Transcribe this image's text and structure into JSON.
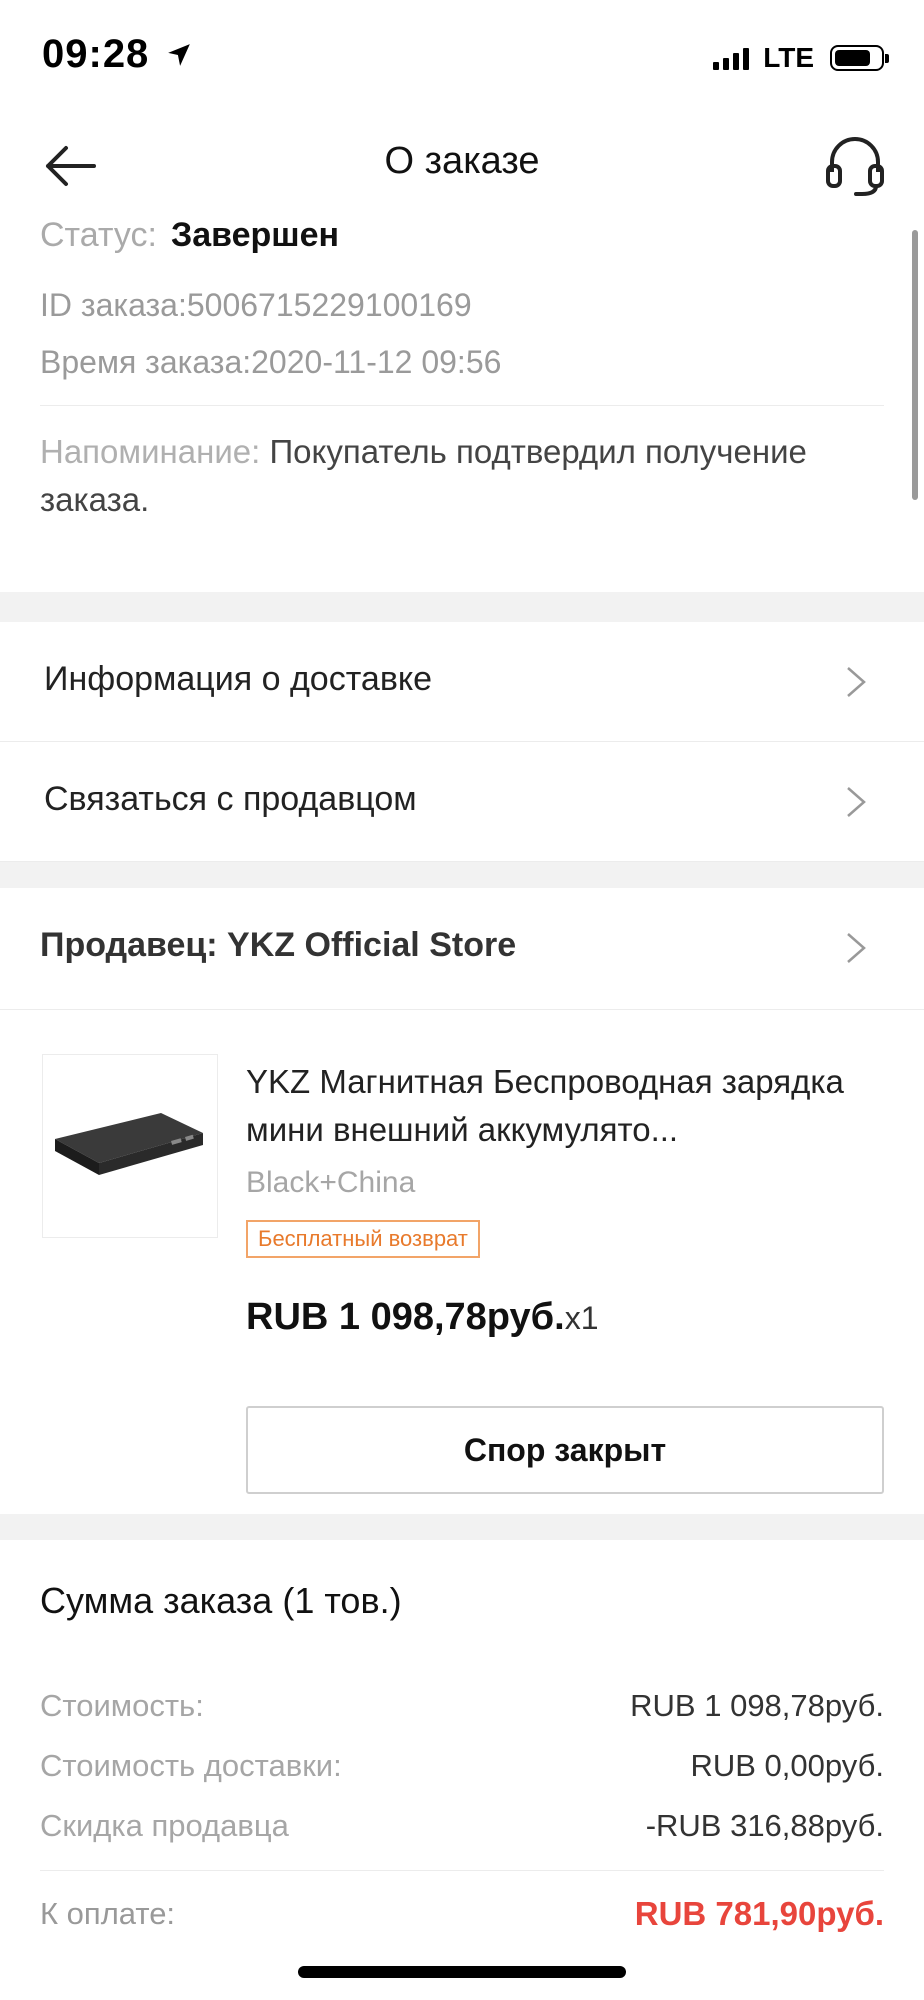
{
  "status_bar": {
    "time": "09:28",
    "network": "LTE"
  },
  "nav": {
    "title": "О заказе"
  },
  "order": {
    "status_label": "Статус:",
    "status_value": "Завершен",
    "id_line": "ID заказа:5006715229100169",
    "time_line": "Время заказа:2020-11-12 09:56",
    "reminder_label": "Напоминание:",
    "reminder_text": " Покупатель подтвердил получение заказа."
  },
  "links": [
    {
      "label": "Информация о доставке"
    },
    {
      "label": "Связаться с продавцом"
    }
  ],
  "seller": {
    "label": "Продавец: YKZ Official Store"
  },
  "product": {
    "title": "YKZ Магнитная Беспроводная зарядка мини внешний аккумулято...",
    "sku": "Black+China",
    "badge": "Бесплатный возврат",
    "price": "RUB 1 098,78руб.",
    "qty": "x1",
    "action": "Спор закрыт"
  },
  "summary": {
    "title": "Сумма заказа (1 тов.)",
    "rows": [
      {
        "key": "Стоимость:",
        "value": "RUB 1 098,78руб."
      },
      {
        "key": "Стоимость доставки:",
        "value": "RUB 0,00руб."
      },
      {
        "key": "Скидка продавца",
        "value": "-RUB 316,88руб."
      }
    ],
    "pay_label": "К оплате:",
    "pay_value": "RUB 781,90руб."
  },
  "colors": {
    "accent_red": "#e8453c",
    "badge_orange": "#e87a2c"
  }
}
